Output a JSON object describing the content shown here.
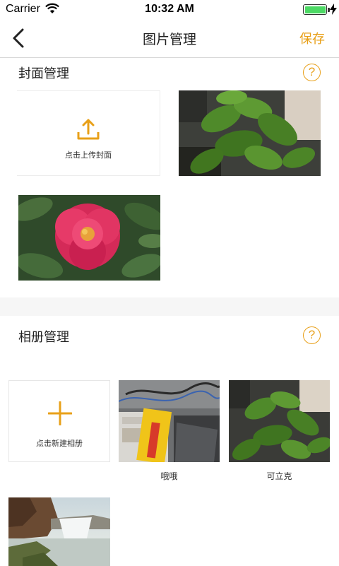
{
  "status_bar": {
    "carrier": "Carrier",
    "time": "10:32 AM",
    "battery_level": 1.0
  },
  "nav": {
    "title": "图片管理",
    "save_label": "保存",
    "back_icon": "chevron-left-icon"
  },
  "cover_section": {
    "title": "封面管理",
    "upload_label": "点击上传封面",
    "upload_icon": "upload-icon",
    "help_glyph": "?",
    "images": [
      "plant-photo",
      "peony-photo"
    ]
  },
  "album_section": {
    "title": "相册管理",
    "add_label": "点击新建相册",
    "add_icon": "plus-icon",
    "help_glyph": "?",
    "albums": [
      {
        "name": "哦哦",
        "image": "office-cables-photo"
      },
      {
        "name": "可立克",
        "image": "plant-photo"
      },
      {
        "name": "",
        "image": "waterfall-photo"
      }
    ]
  },
  "colors": {
    "accent": "#e8a019",
    "battery": "#4cd964",
    "section_gap": "#f6f6f6"
  }
}
